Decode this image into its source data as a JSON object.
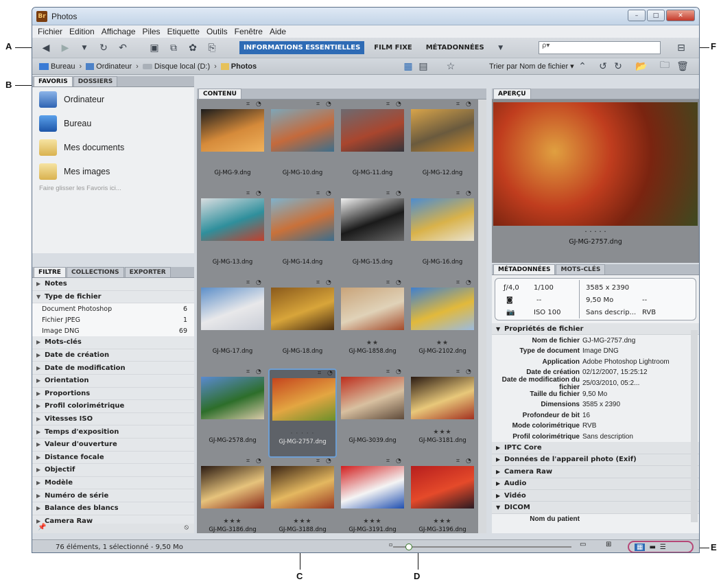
{
  "window": {
    "title": "Photos",
    "min": "–",
    "max": "□",
    "close": "✕"
  },
  "menu": [
    "Fichier",
    "Edition",
    "Affichage",
    "Piles",
    "Etiquette",
    "Outils",
    "Fenêtre",
    "Aide"
  ],
  "workspaces": [
    "INFORMATIONS ESSENTIELLES",
    "FILM FIXE",
    "MÉTADONNÉES"
  ],
  "search": {
    "value": "ρ▾"
  },
  "path": [
    "Bureau",
    "Ordinateur",
    "Disque local (D:)",
    "Photos"
  ],
  "sort_label": "Trier par Nom de fichier ▾",
  "callouts": [
    "A",
    "B",
    "C",
    "D",
    "E",
    "F"
  ],
  "favorites": {
    "tabs": [
      "FAVORIS",
      "DOSSIERS"
    ],
    "items": [
      "Ordinateur",
      "Bureau",
      "Mes documents",
      "Mes images"
    ],
    "hint": "Faire glisser les Favoris ici..."
  },
  "filter": {
    "tabs": [
      "FILTRE",
      "COLLECTIONS",
      "EXPORTER"
    ],
    "rows": [
      {
        "label": "Notes",
        "open": false
      },
      {
        "label": "Type de fichier",
        "open": true,
        "subs": [
          {
            "name": "Document Photoshop",
            "count": "6"
          },
          {
            "name": "Fichier JPEG",
            "count": "1"
          },
          {
            "name": "Image DNG",
            "count": "69"
          }
        ]
      },
      {
        "label": "Mots-clés",
        "open": false
      },
      {
        "label": "Date de création",
        "open": false
      },
      {
        "label": "Date de modification",
        "open": false
      },
      {
        "label": "Orientation",
        "open": false
      },
      {
        "label": "Proportions",
        "open": false
      },
      {
        "label": "Profil colorimétrique",
        "open": false
      },
      {
        "label": "Vitesses ISO",
        "open": false
      },
      {
        "label": "Temps d'exposition",
        "open": false
      },
      {
        "label": "Valeur d'ouverture",
        "open": false
      },
      {
        "label": "Distance focale",
        "open": false
      },
      {
        "label": "Objectif",
        "open": false
      },
      {
        "label": "Modèle",
        "open": false
      },
      {
        "label": "Numéro de série",
        "open": false
      },
      {
        "label": "Balance des blancs",
        "open": false
      },
      {
        "label": "Camera Raw",
        "open": false
      }
    ]
  },
  "content": {
    "tab": "CONTENU",
    "thumbs": [
      {
        "name": "GJ-MG-9.dng",
        "stars": "",
        "c": [
          "#1c1c1c",
          "#d58a3a",
          "#f0b25c"
        ]
      },
      {
        "name": "GJ-MG-10.dng",
        "stars": "",
        "c": [
          "#7ea6b8",
          "#c46a3c",
          "#3d6f8c"
        ]
      },
      {
        "name": "GJ-MG-11.dng",
        "stars": "",
        "c": [
          "#6d6a70",
          "#a9462e",
          "#34343a"
        ]
      },
      {
        "name": "GJ-MG-12.dng",
        "stars": "",
        "c": [
          "#d8a44a",
          "#6a5a3e",
          "#c98a2c"
        ]
      },
      {
        "name": "GJ-MG-13.dng",
        "stars": "",
        "c": [
          "#d9dde0",
          "#2f8f9c",
          "#c23f2c"
        ]
      },
      {
        "name": "GJ-MG-14.dng",
        "stars": "",
        "c": [
          "#7fb2cc",
          "#c9713a",
          "#3b6e8e"
        ]
      },
      {
        "name": "GJ-MG-15.dng",
        "stars": "",
        "c": [
          "#f1f1f1",
          "#1a1a1a",
          "#666666"
        ]
      },
      {
        "name": "GJ-MG-16.dng",
        "stars": "",
        "c": [
          "#4d8ccf",
          "#d9b24a",
          "#e8e2d0"
        ]
      },
      {
        "name": "GJ-MG-17.dng",
        "stars": "",
        "c": [
          "#5d8fc9",
          "#e8e8ea",
          "#c9cdd6"
        ]
      },
      {
        "name": "GJ-MG-18.dng",
        "stars": "",
        "c": [
          "#8a5a1c",
          "#d8a53a",
          "#4a2e12"
        ]
      },
      {
        "name": "GJ-MG-1858.dng",
        "stars": "★★",
        "c": [
          "#c9a47a",
          "#e0d2b8",
          "#a34a2a"
        ]
      },
      {
        "name": "GJ-MG-2102.dng",
        "stars": "★★",
        "c": [
          "#3f7fcf",
          "#e2b93b",
          "#9bbbe0"
        ]
      },
      {
        "name": "GJ-MG-2578.dng",
        "stars": "",
        "c": [
          "#5a8ad0",
          "#2d6e2a",
          "#d8c9a8"
        ]
      },
      {
        "name": "GJ-MG-2757.dng",
        "stars": "· · · · ·",
        "c": [
          "#c5451e",
          "#e3a642",
          "#6b8f2a"
        ]
      },
      {
        "name": "GJ-MG-3039.dng",
        "stars": "",
        "c": [
          "#bd2e1e",
          "#d8c0a0",
          "#5e4a3a"
        ]
      },
      {
        "name": "GJ-MG-3181.dng",
        "stars": "★★★",
        "c": [
          "#2a1a12",
          "#e8c87a",
          "#a23020"
        ]
      },
      {
        "name": "GJ-MG-3186.dng",
        "stars": "★★★",
        "c": [
          "#2a1a12",
          "#e6c37c",
          "#8a2a1a"
        ]
      },
      {
        "name": "GJ-MG-3188.dng",
        "stars": "★★★",
        "c": [
          "#3a2414",
          "#e4b860",
          "#9a3a22"
        ]
      },
      {
        "name": "GJ-MG-3191.dng",
        "stars": "★★★",
        "c": [
          "#d21f1f",
          "#f4f4f4",
          "#1f4fb0"
        ]
      },
      {
        "name": "GJ-MG-3196.dng",
        "stars": "★★★",
        "c": [
          "#b61e1e",
          "#e54a2a",
          "#2a1a22"
        ]
      }
    ]
  },
  "preview": {
    "tab": "APERÇU",
    "filename": "GJ-MG-2757.dng",
    "dots": "· · · · ·"
  },
  "metadata": {
    "tabs": [
      "MÉTADONNÉES",
      "MOTS-CLÉS"
    ],
    "summary": {
      "aperture": "ƒ/4,0",
      "shutter": "1/100",
      "dims": "3585 x 2390",
      "metering": "--",
      "size": "9,50 Mo",
      "size2": "--",
      "iso": "ISO 100",
      "profile": "Sans descrip...",
      "mode": "RVB"
    },
    "section": "Propriétés de fichier",
    "rows": [
      {
        "k": "Nom de fichier",
        "v": "GJ-MG-2757.dng"
      },
      {
        "k": "Type de document",
        "v": "Image DNG"
      },
      {
        "k": "Application",
        "v": "Adobe Photoshop Lightroom"
      },
      {
        "k": "Date de création",
        "v": "02/12/2007, 15:25:12"
      },
      {
        "k": "Date de modification du fichier",
        "v": "25/03/2010, 05:2..."
      },
      {
        "k": "Taille du fichier",
        "v": "9,50 Mo"
      },
      {
        "k": "Dimensions",
        "v": "3585 x 2390"
      },
      {
        "k": "Profondeur de bit",
        "v": "16"
      },
      {
        "k": "Mode colorimétrique",
        "v": "RVB"
      },
      {
        "k": "Profil colorimétrique",
        "v": "Sans description"
      }
    ],
    "sections": [
      "IPTC Core",
      "Données de l'appareil photo (Exif)",
      "Camera Raw",
      "Audio",
      "Vidéo"
    ],
    "open_section": "DICOM",
    "dicom_row": "Nom du patient"
  },
  "status": {
    "text": "76 éléments, 1 sélectionné - 9,50 Mo",
    "zoom": 0.07
  }
}
